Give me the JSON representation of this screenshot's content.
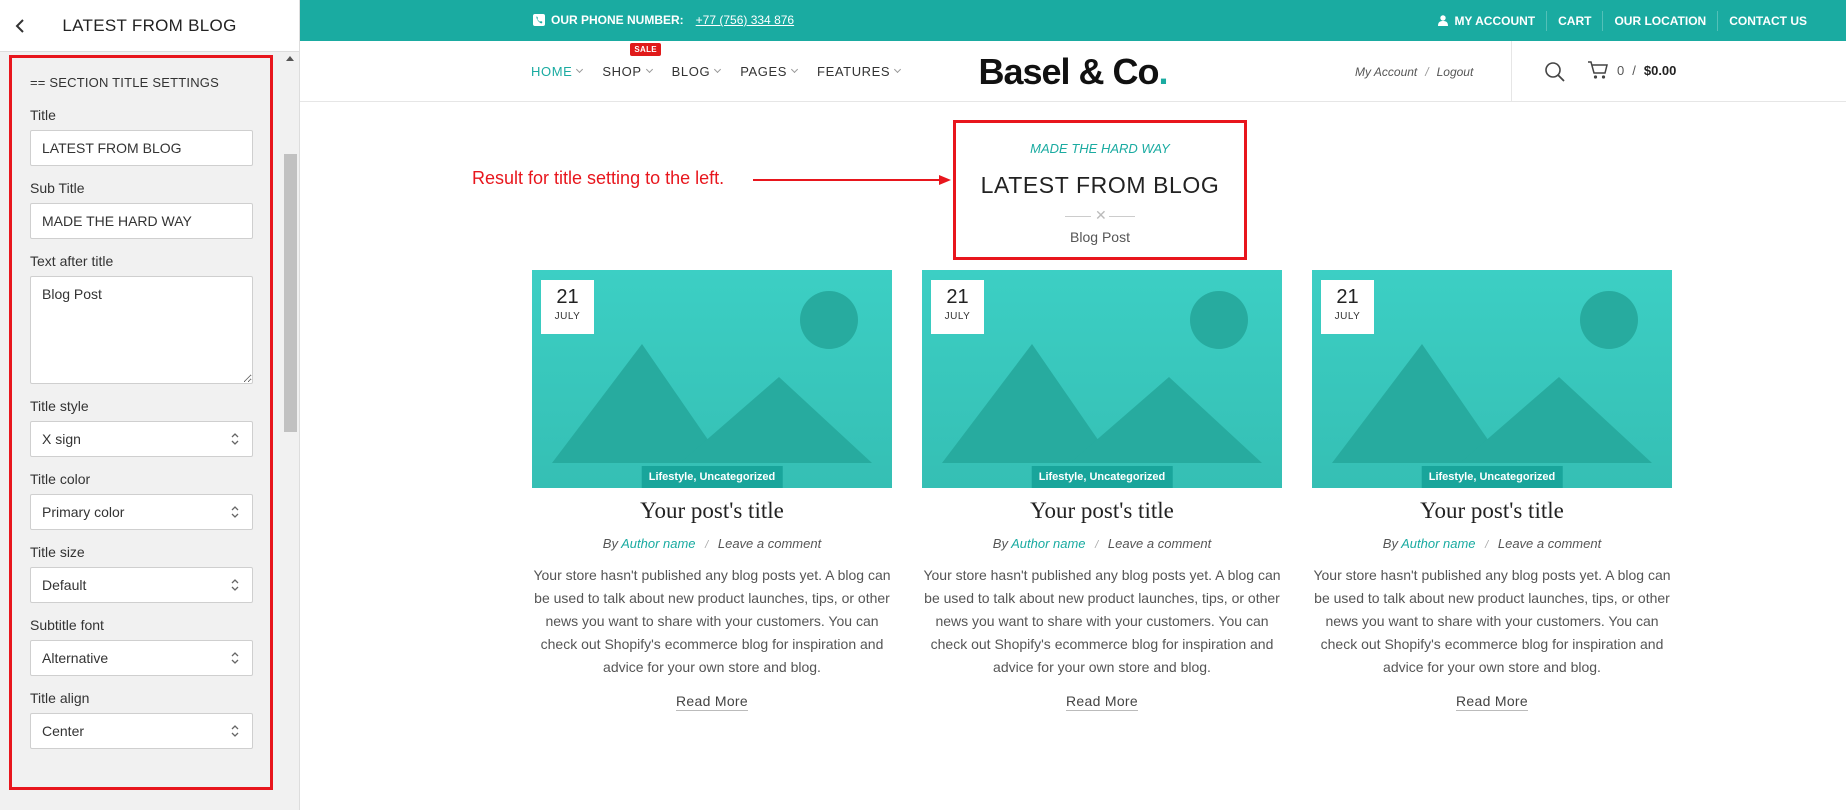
{
  "panel": {
    "title": "LATEST FROM BLOG",
    "section_label": "== SECTION TITLE SETTINGS",
    "fields": {
      "title": {
        "label": "Title",
        "value": "LATEST FROM BLOG"
      },
      "sub_title": {
        "label": "Sub Title",
        "value": "MADE THE HARD WAY"
      },
      "text_after": {
        "label": "Text after title",
        "value": "Blog Post"
      },
      "title_style": {
        "label": "Title style",
        "value": "X sign"
      },
      "title_color": {
        "label": "Title color",
        "value": "Primary color"
      },
      "title_size": {
        "label": "Title size",
        "value": "Default"
      },
      "subtitle_font": {
        "label": "Subtitle font",
        "value": "Alternative"
      },
      "title_align": {
        "label": "Title align",
        "value": "Center"
      }
    }
  },
  "topbar": {
    "phone_label": "OUR PHONE NUMBER:",
    "phone_number": "+77 (756) 334 876",
    "links": [
      "MY ACCOUNT",
      "CART",
      "OUR LOCATION",
      "CONTACT US"
    ]
  },
  "header": {
    "nav": [
      "HOME",
      "SHOP",
      "BLOG",
      "PAGES",
      "FEATURES"
    ],
    "sale_badge": "SALE",
    "logo_text": "Basel & Co",
    "logo_dot": ".",
    "my_account": "My Account",
    "separator": "/",
    "logout": "Logout",
    "cart_count": "0",
    "cart_sep": "/",
    "cart_total": "$0.00"
  },
  "section": {
    "subtitle": "MADE THE HARD WAY",
    "title": "LATEST FROM BLOG",
    "divider_glyph": "✕",
    "after_title": "Blog Post"
  },
  "annotation": "Result for title setting to the left.",
  "posts": [
    {
      "day": "21",
      "month": "JULY",
      "categories": "Lifestyle, Uncategorized",
      "title": "Your post's title",
      "by": "By",
      "author": "Author name",
      "meta_sep": "/",
      "comment": "Leave a comment",
      "excerpt": "Your store hasn't published any blog posts yet. A blog can be used to talk about new product launches, tips, or other news you want to share with your customers. You can check out Shopify's ecommerce blog for inspiration and advice for your own store and blog.",
      "read_more": "Read More"
    },
    {
      "day": "21",
      "month": "JULY",
      "categories": "Lifestyle, Uncategorized",
      "title": "Your post's title",
      "by": "By",
      "author": "Author name",
      "meta_sep": "/",
      "comment": "Leave a comment",
      "excerpt": "Your store hasn't published any blog posts yet. A blog can be used to talk about new product launches, tips, or other news you want to share with your customers. You can check out Shopify's ecommerce blog for inspiration and advice for your own store and blog.",
      "read_more": "Read More"
    },
    {
      "day": "21",
      "month": "JULY",
      "categories": "Lifestyle, Uncategorized",
      "title": "Your post's title",
      "by": "By",
      "author": "Author name",
      "meta_sep": "/",
      "comment": "Leave a comment",
      "excerpt": "Your store hasn't published any blog posts yet. A blog can be used to talk about new product launches, tips, or other news you want to share with your customers. You can check out Shopify's ecommerce blog for inspiration and advice for your own store and blog.",
      "read_more": "Read More"
    }
  ],
  "colors": {
    "primary": "#1aaba1",
    "annotation_red": "#e8161d",
    "sale_red": "#e01a1a",
    "thumb_teal": "#3ccfc4"
  },
  "icons": [
    "back-chevron-icon",
    "select-arrows-icon",
    "phone-icon",
    "user-icon",
    "search-icon",
    "cart-icon",
    "collapse-arrow-icon",
    "image-placeholder-icon"
  ]
}
